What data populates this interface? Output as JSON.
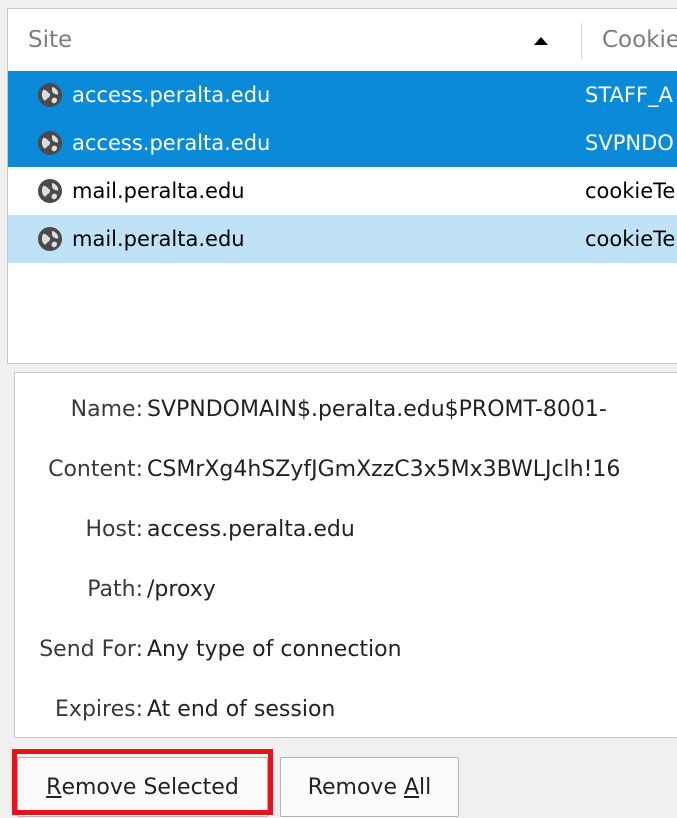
{
  "list": {
    "columns": {
      "site": "Site",
      "cookie": "Cookie"
    },
    "rows": [
      {
        "site": "access.peralta.edu",
        "cookie": "STAFF_A",
        "state": "selected"
      },
      {
        "site": "access.peralta.edu",
        "cookie": "SVPNDO",
        "state": "selected"
      },
      {
        "site": "mail.peralta.edu",
        "cookie": "cookieTe",
        "state": "plain"
      },
      {
        "site": "mail.peralta.edu",
        "cookie": "cookieTe",
        "state": "hover"
      }
    ]
  },
  "details": {
    "name": {
      "label": "Name:",
      "value": "SVPNDOMAIN$.peralta.edu$PROMT-8001-"
    },
    "content": {
      "label": "Content:",
      "value": "CSMrXg4hSZyfJGmXzzC3x5Mx3BWLJclh!16"
    },
    "host": {
      "label": "Host:",
      "value": "access.peralta.edu"
    },
    "path": {
      "label": "Path:",
      "value": "/proxy"
    },
    "send_for": {
      "label": "Send For:",
      "value": "Any type of connection"
    },
    "expires": {
      "label": "Expires:",
      "value": "At end of session"
    }
  },
  "buttons": {
    "remove_selected": {
      "mnemonic": "R",
      "rest": "emove Selected"
    },
    "remove_all": {
      "pre": "Remove ",
      "mnemonic": "A",
      "rest": "ll"
    }
  },
  "colors": {
    "selection": "#0b8ad8",
    "hover": "#bfe2f6",
    "highlight": "#e3141f"
  },
  "icons": {
    "site_icon": "globe-icon",
    "sort_icon": "sort-ascending-icon"
  }
}
